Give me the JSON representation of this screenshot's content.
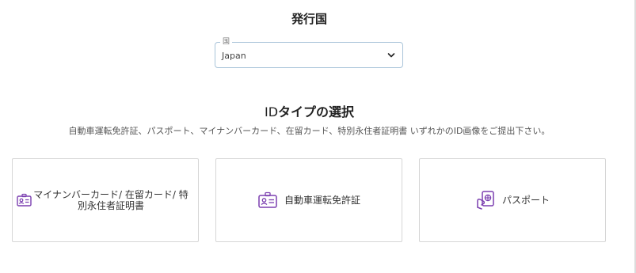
{
  "country_section": {
    "title": "発行国",
    "select": {
      "label": "国",
      "value": "Japan"
    }
  },
  "id_section": {
    "title_prefix": "ID",
    "title_main": "タイプの選択",
    "description": "自動車運転免許証、パスポート、マイナンバーカード、在留カード、特別永住者証明書 いずれかのID画像をご提出下さい。",
    "options": [
      {
        "label": "マイナンバーカード/ 在留カード/ 特別永住者証明書",
        "icon": "id-card-icon"
      },
      {
        "label": "自動車運転免許証",
        "icon": "driver-license-icon"
      },
      {
        "label": "パスポート",
        "icon": "passport-icon"
      }
    ]
  },
  "colors": {
    "accent_icon": "#7b3fb0",
    "select_border": "#a9c4d9",
    "card_border": "#d6d6d6"
  }
}
